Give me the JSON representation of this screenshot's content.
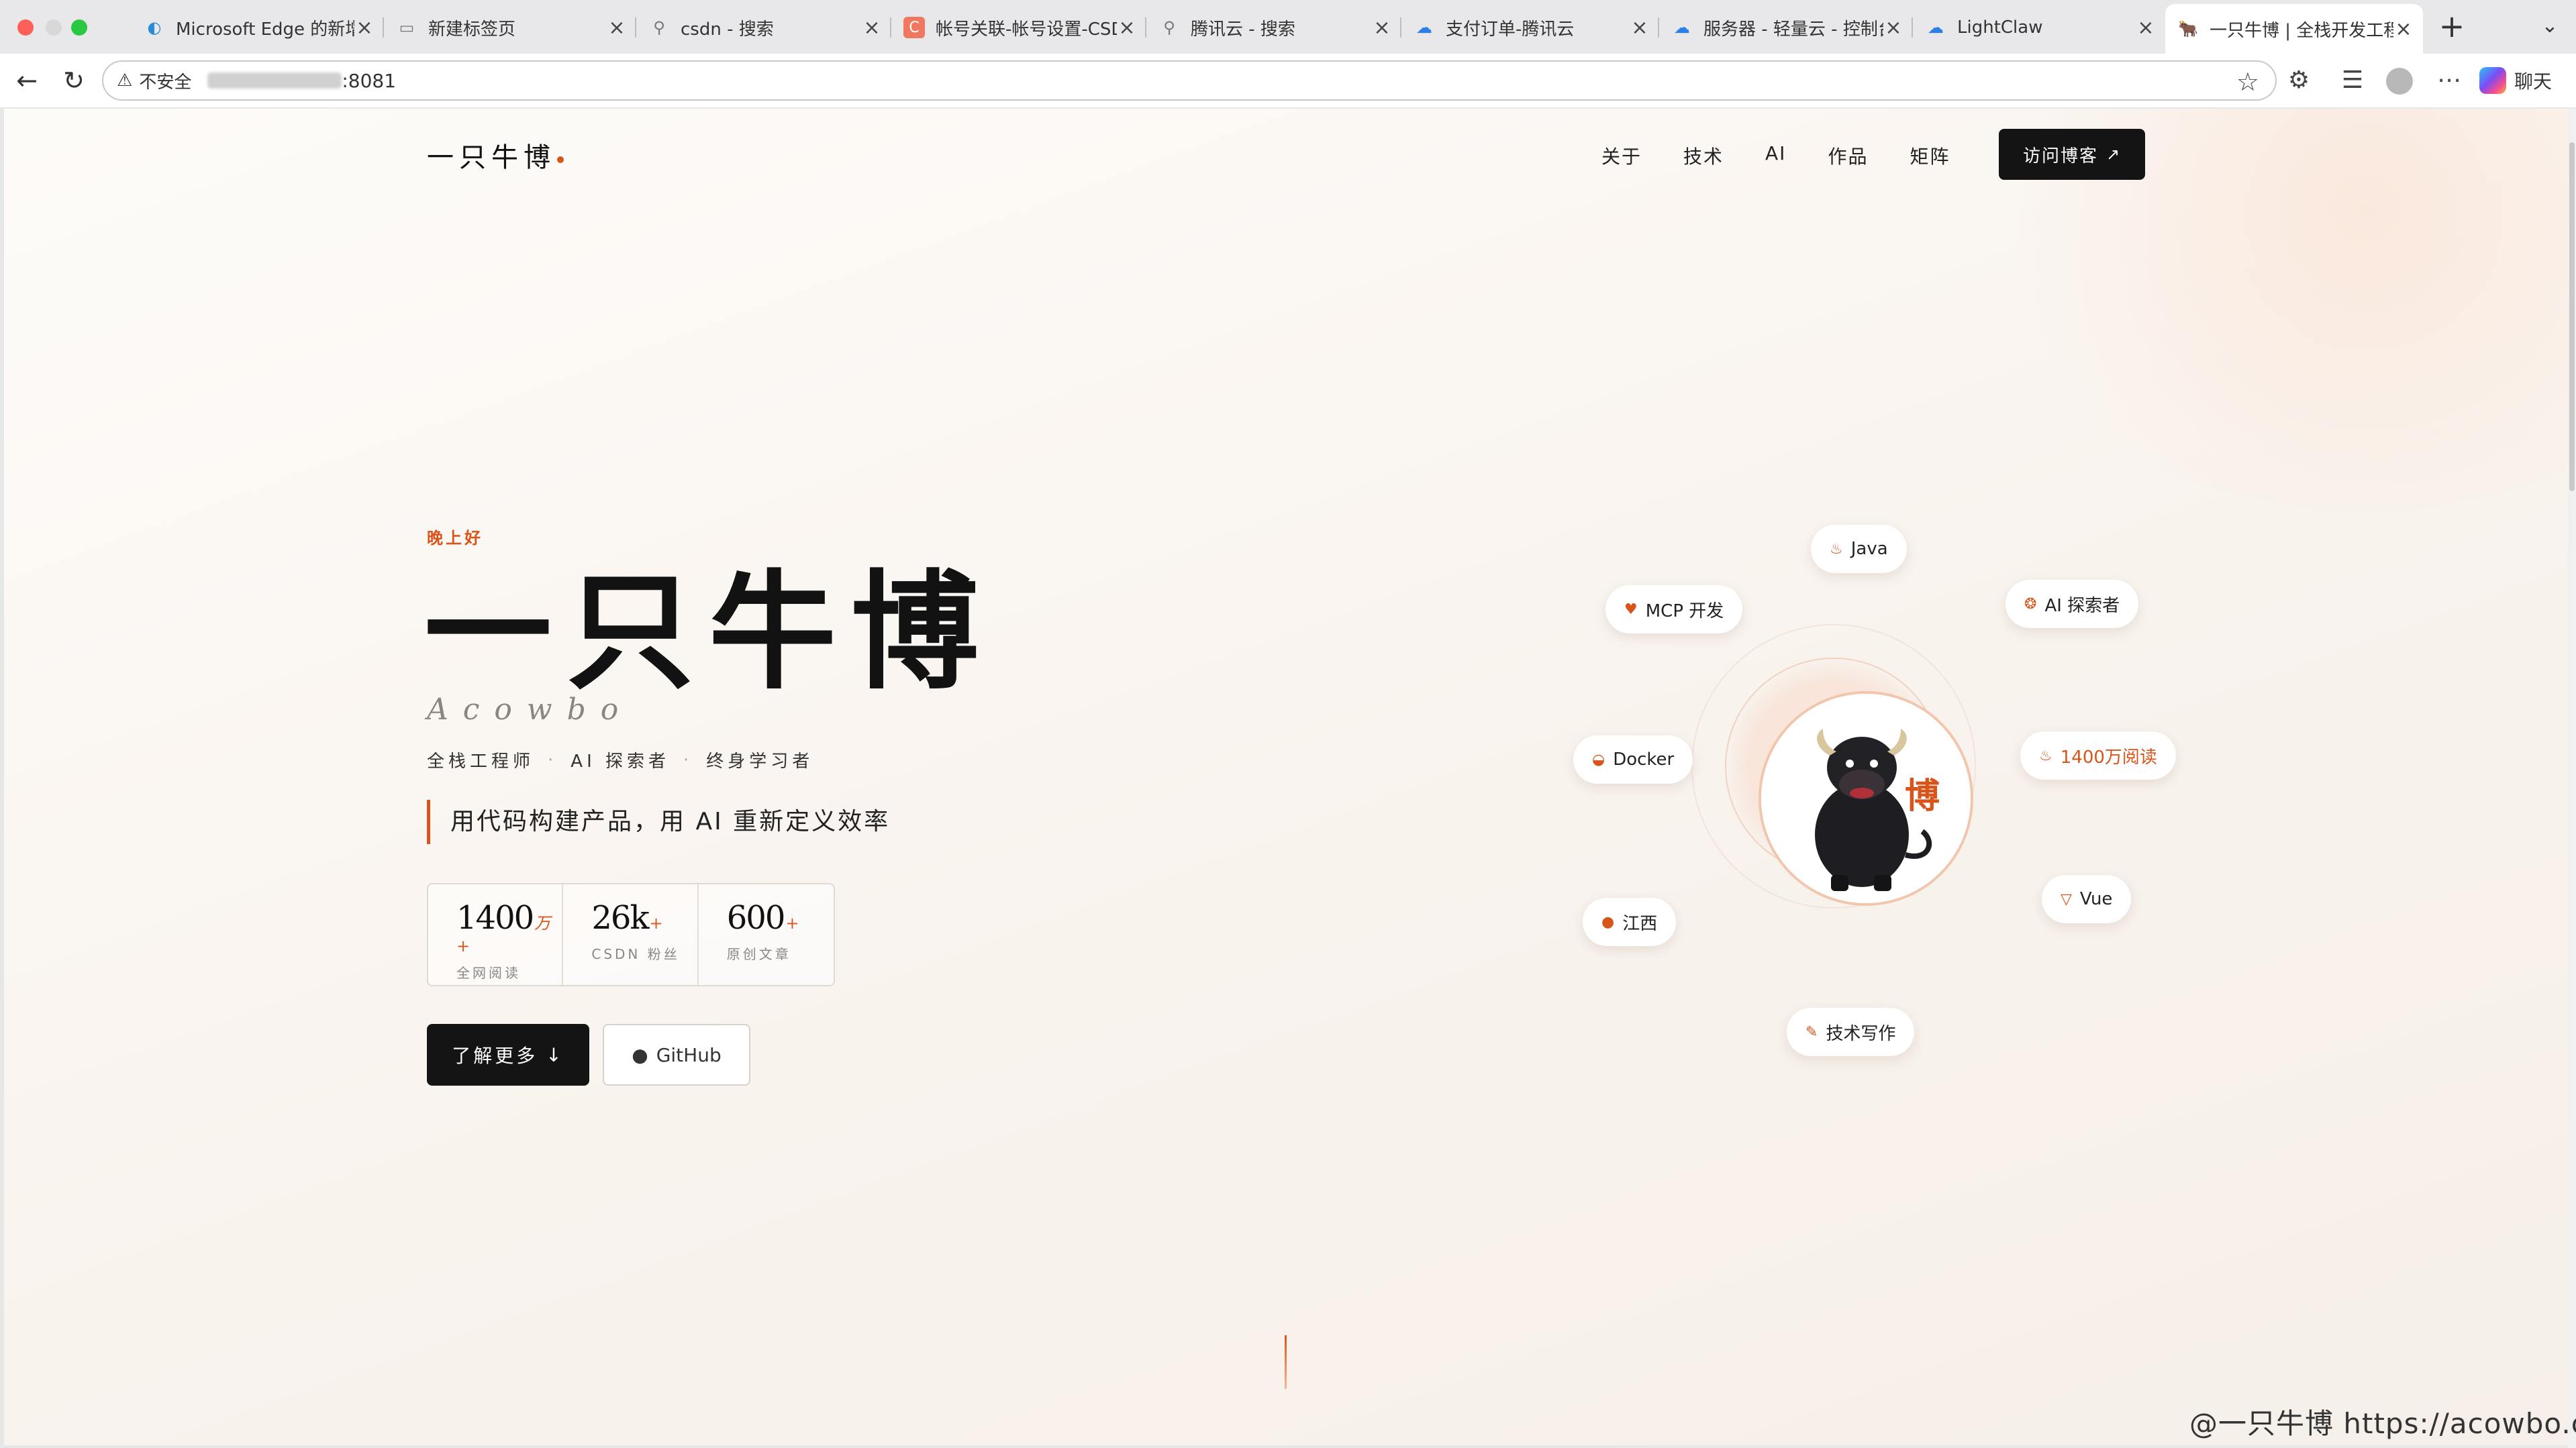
{
  "browser": {
    "tabs": [
      {
        "title": "Microsoft Edge 的新增功能",
        "icon": "edge-icon"
      },
      {
        "title": "新建标签页",
        "icon": "newtab-page-icon"
      },
      {
        "title": "csdn - 搜索",
        "icon": "search-icon"
      },
      {
        "title": "帐号关联-帐号设置-CSDN",
        "icon": "csdn-icon"
      },
      {
        "title": "腾讯云 - 搜索",
        "icon": "search-icon"
      },
      {
        "title": "支付订单-腾讯云",
        "icon": "cloud-icon"
      },
      {
        "title": "服务器 - 轻量云 - 控制台",
        "icon": "cloud-icon"
      },
      {
        "title": "LightClaw",
        "icon": "cloud-icon"
      },
      {
        "title": "一只牛博 | 全栈开发工程师",
        "icon": "bull-icon",
        "active": true
      }
    ],
    "close_glyph": "×",
    "new_tab_glyph": "+",
    "address": {
      "security_label": "不安全",
      "port": ":8081"
    },
    "chat_label": "聊天"
  },
  "site": {
    "logo": "一只牛博",
    "nav": [
      "关于",
      "技术",
      "AI",
      "作品",
      "矩阵"
    ],
    "visit_button": "访问博客",
    "accent_color": "#d9541a"
  },
  "hero": {
    "greeting": "晚上好",
    "title": "一只牛博",
    "subtitle_en": "Acowbo",
    "roles": [
      "全栈工程师",
      "AI 探索者",
      "终身学习者"
    ],
    "slogan": "用代码构建产品，用 AI 重新定义效率",
    "stats": [
      {
        "value": "1400",
        "unit": "万+",
        "label": "全网阅读"
      },
      {
        "value": "26k",
        "unit": "+",
        "label": "CSDN 粉丝"
      },
      {
        "value": "600",
        "unit": "+",
        "label": "原创文章"
      }
    ],
    "learn_more": "了解更多",
    "github": "GitHub"
  },
  "orbit": {
    "avatar_char": "博",
    "chips": [
      {
        "label": "Java",
        "icon": "java-icon"
      },
      {
        "label": "MCP 开发",
        "icon": "mcp-icon"
      },
      {
        "label": "AI 探索者",
        "icon": "brain-icon"
      },
      {
        "label": "Docker",
        "icon": "docker-icon"
      },
      {
        "label": "1400万阅读",
        "icon": "fire-icon"
      },
      {
        "label": "Vue",
        "icon": "vue-icon"
      },
      {
        "label": "江西",
        "icon": "location-icon"
      },
      {
        "label": "技术写作",
        "icon": "pen-icon"
      }
    ]
  },
  "watermark": "@一只牛博 https://acowbo.com"
}
